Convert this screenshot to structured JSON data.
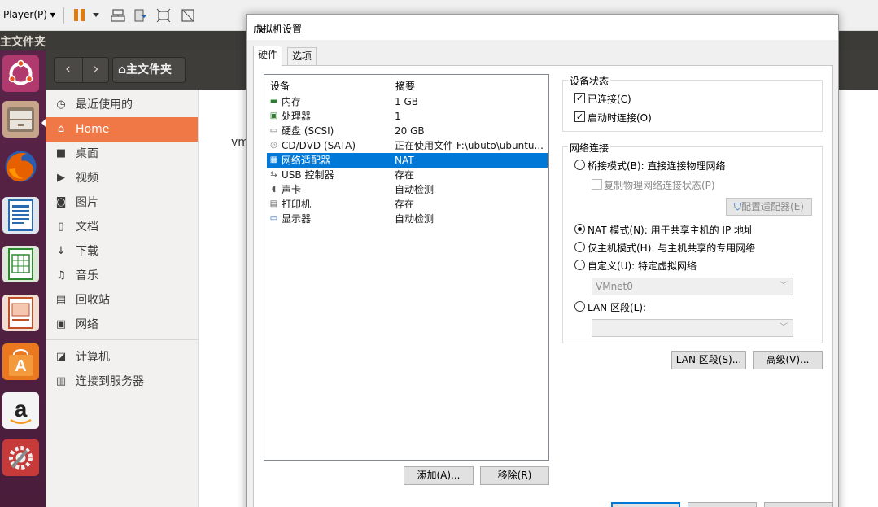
{
  "vm_toolbar": {
    "player_menu": "Player(P)",
    "icons": [
      "pause-icon",
      "send-ctrl-alt-del-icon",
      "removable-devices-icon",
      "fullscreen-icon",
      "unity-icon"
    ]
  },
  "ubuntu": {
    "topbar_title": "主文件夹",
    "launcher": [
      "ubuntu-dash-icon",
      "file-manager-icon",
      "firefox-icon",
      "writer-icon",
      "calc-icon",
      "impress-icon",
      "software-center-icon",
      "amazon-icon",
      "system-settings-icon"
    ],
    "path_button": "主文件夹",
    "path_icon": "⌂",
    "places": [
      {
        "label": "最近使用的",
        "icon": "◷",
        "icon_name": "recent-icon"
      },
      {
        "label": "Home",
        "icon": "⌂",
        "icon_name": "home-icon",
        "active": true
      },
      {
        "label": "桌面",
        "icon": "■",
        "icon_name": "desktop-folder-icon"
      },
      {
        "label": "视频",
        "icon": "▶",
        "icon_name": "video-icon"
      },
      {
        "label": "图片",
        "icon": "◙",
        "icon_name": "pictures-icon"
      },
      {
        "label": "文档",
        "icon": "▯",
        "icon_name": "documents-icon"
      },
      {
        "label": "下载",
        "icon": "↓",
        "icon_name": "download-icon"
      },
      {
        "label": "音乐",
        "icon": "♫",
        "icon_name": "music-icon"
      },
      {
        "label": "回收站",
        "icon": "▤",
        "icon_name": "trash-icon"
      },
      {
        "label": "网络",
        "icon": "▣",
        "icon_name": "network-icon"
      },
      {
        "label": "计算机",
        "icon": "◪",
        "icon_name": "computer-icon"
      },
      {
        "label": "连接到服务器",
        "icon": "▥",
        "icon_name": "connect-server-icon"
      }
    ],
    "stray_text": "vm"
  },
  "dialog": {
    "title": "虚拟机设置",
    "tabs": [
      "硬件",
      "选项"
    ],
    "device_list": {
      "headers": [
        "设备",
        "摘要"
      ],
      "rows": [
        {
          "name": "内存",
          "summary": "1 GB",
          "icon": "memory-icon",
          "glyph": "▬",
          "color": "#2e7d32"
        },
        {
          "name": "处理器",
          "summary": "1",
          "icon": "processor-icon",
          "glyph": "▣",
          "color": "#2e7d32"
        },
        {
          "name": "硬盘 (SCSI)",
          "summary": "20 GB",
          "icon": "hard-disk-icon",
          "glyph": "▭",
          "color": "#555555"
        },
        {
          "name": "CD/DVD (SATA)",
          "summary": "正在使用文件 F:\\ubuto\\ubuntu...",
          "icon": "cd-dvd-icon",
          "glyph": "◎",
          "color": "#777777"
        },
        {
          "name": "网络适配器",
          "summary": "NAT",
          "icon": "network-adapter-icon",
          "glyph": "▦",
          "color": "#1565c0",
          "selected": true
        },
        {
          "name": "USB 控制器",
          "summary": "存在",
          "icon": "usb-icon",
          "glyph": "⇆",
          "color": "#555555"
        },
        {
          "name": "声卡",
          "summary": "自动检测",
          "icon": "sound-card-icon",
          "glyph": "◖",
          "color": "#555555"
        },
        {
          "name": "打印机",
          "summary": "存在",
          "icon": "printer-icon",
          "glyph": "▤",
          "color": "#555555"
        },
        {
          "name": "显示器",
          "summary": "自动检测",
          "icon": "display-icon",
          "glyph": "▭",
          "color": "#1565c0"
        }
      ]
    },
    "add_button": "添加(A)...",
    "remove_button": "移除(R)",
    "device_status": {
      "label": "设备状态",
      "connected": "已连接(C)",
      "connect_at_power_on": "启动时连接(O)"
    },
    "network_connection": {
      "label": "网络连接",
      "bridged": "桥接模式(B): 直接连接物理网络",
      "replicate": "复制物理网络连接状态(P)",
      "configure_adapters": "配置适配器(E)",
      "nat": "NAT 模式(N): 用于共享主机的 IP 地址",
      "host_only": "仅主机模式(H): 与主机共享的专用网络",
      "custom": "自定义(U): 特定虚拟网络",
      "vmnet_value": "VMnet0",
      "lan_segment": "LAN 区段(L):",
      "lan_value": ""
    },
    "lan_segments_button": "LAN 区段(S)...",
    "advanced_button": "高级(V)..."
  }
}
